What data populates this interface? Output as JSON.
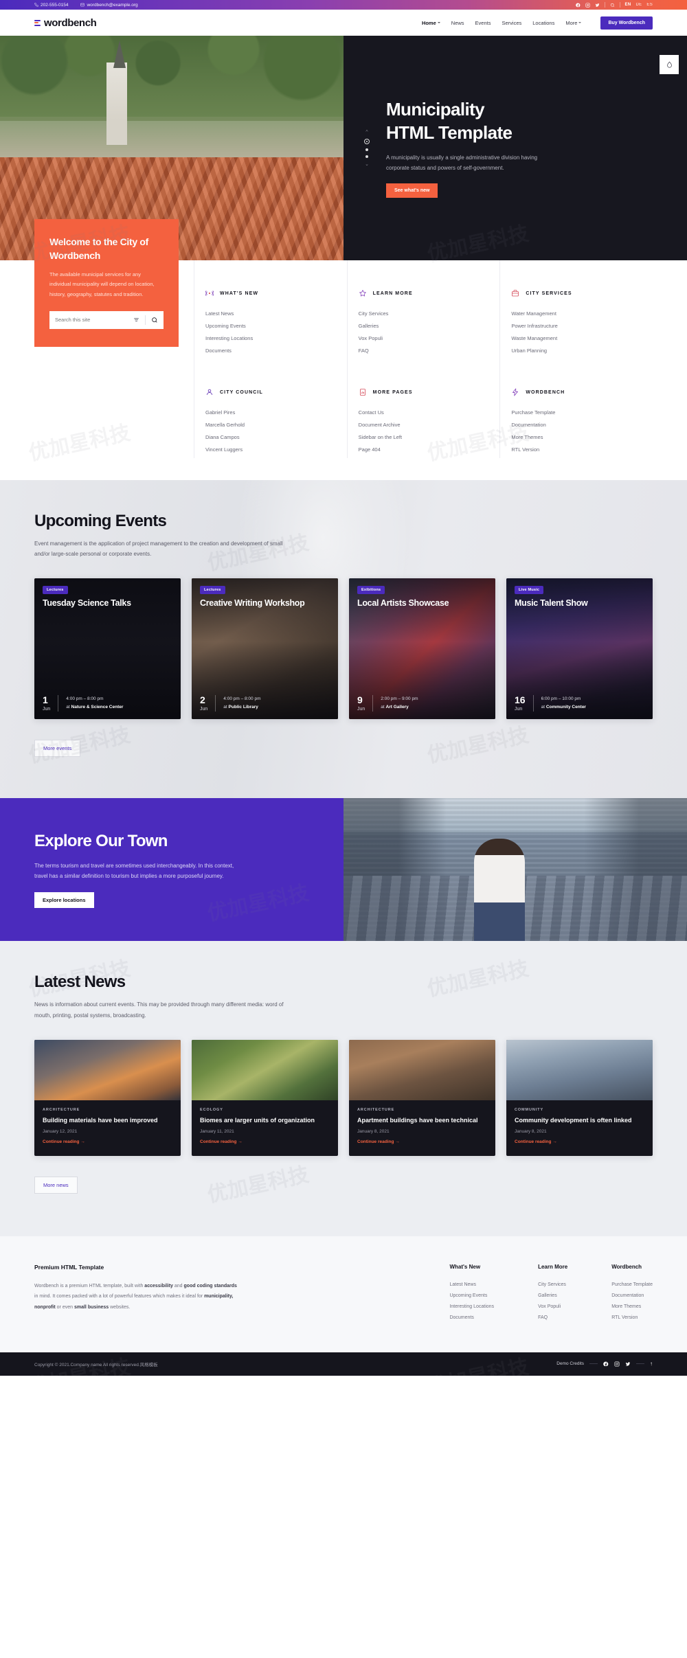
{
  "topbar": {
    "phone": "202-555-0154",
    "email": "wordbench@example.org",
    "socials": [
      "facebook-icon",
      "instagram-icon",
      "twitter-icon"
    ],
    "search_icon": "search-icon",
    "languages": [
      {
        "code": "EN",
        "active": true
      },
      {
        "code": "DE",
        "active": false
      },
      {
        "code": "ES",
        "active": false
      }
    ],
    "gradient_from": "#4b2bbd",
    "gradient_to": "#f4613f"
  },
  "header": {
    "logo": "wordbench",
    "nav": [
      {
        "label": "Home",
        "has_caret": true,
        "active": true
      },
      {
        "label": "News",
        "has_caret": false,
        "active": false
      },
      {
        "label": "Events",
        "has_caret": false,
        "active": false
      },
      {
        "label": "Services",
        "has_caret": false,
        "active": false
      },
      {
        "label": "Locations",
        "has_caret": false,
        "active": false
      },
      {
        "label": "More",
        "has_caret": true,
        "active": false
      }
    ],
    "cta": "Buy Wordbench",
    "cta_color": "#4b2bbd"
  },
  "hero": {
    "title_line1": "Municipality",
    "title_line2": "HTML Template",
    "paragraph": "A municipality is usually a single administrative division having corporate status and powers of self-government.",
    "button": "See what's new",
    "button_color": "#f4613f",
    "slides_total": 3,
    "slide_current": 1,
    "badge_icon": "droplet-icon"
  },
  "welcome": {
    "title": "Welcome to the City of Wordbench",
    "paragraph": "The available municipal services for any individual municipality will depend on location, history, geography, statutes and tradition.",
    "search_placeholder": "Search this site",
    "search_value": "",
    "filter_icon": "filter-icon",
    "search_icon": "search-icon",
    "bg_color": "#f4613f"
  },
  "quicklinks": [
    {
      "icon": "broadcast-icon",
      "title": "WHAT'S NEW",
      "items": [
        "Latest News",
        "Upcoming Events",
        "Interesting Locations",
        "Documents"
      ]
    },
    {
      "icon": "star-icon",
      "title": "LEARN MORE",
      "items": [
        "City Services",
        "Galleries",
        "Vox Populi",
        "FAQ"
      ]
    },
    {
      "icon": "briefcase-icon",
      "title": "CITY SERVICES",
      "items": [
        "Water Management",
        "Power Infrastructure",
        "Waste Management",
        "Urban Planning"
      ]
    },
    {
      "icon": "user-icon",
      "title": "CITY COUNCIL",
      "items": [
        "Gabriel Pires",
        "Marcella Gerhold",
        "Diana Campos",
        "Vincent Luggers"
      ]
    },
    {
      "icon": "chart-clipboard-icon",
      "title": "MORE PAGES",
      "items": [
        "Contact Us",
        "Document Archive",
        "Sidebar on the Left",
        "Page 404"
      ]
    },
    {
      "icon": "bolt-icon",
      "title": "WORDBENCH",
      "items": [
        "Purchase Template",
        "Documentation",
        "More Themes",
        "RTL Version"
      ]
    }
  ],
  "events": {
    "heading": "Upcoming Events",
    "paragraph": "Event management is the application of project management to the creation and development of small and/or large-scale personal or corporate events.",
    "more_button": "More events",
    "cards": [
      {
        "tag": "Lectures",
        "title": "Tuesday Science Talks",
        "day": "1",
        "month": "Jun",
        "time": "4:00 pm – 8:00 pm",
        "place_prefix": "at ",
        "place": "Nature & Science Center"
      },
      {
        "tag": "Lectures",
        "title": "Creative Writing Workshop",
        "day": "2",
        "month": "Jun",
        "time": "4:00 pm – 8:00 pm",
        "place_prefix": "at ",
        "place": "Public Library"
      },
      {
        "tag": "Exibitions",
        "title": "Local Artists Showcase",
        "day": "9",
        "month": "Jun",
        "time": "2:00 pm – 9:00 pm",
        "place_prefix": "at ",
        "place": "Art Gallery"
      },
      {
        "tag": "Live Music",
        "title": "Music Talent Show",
        "day": "16",
        "month": "Jun",
        "time": "6:00 pm – 10:00 pm",
        "place_prefix": "at ",
        "place": "Community Center"
      }
    ]
  },
  "explore": {
    "heading": "Explore Our Town",
    "paragraph": "The terms tourism and travel are sometimes used interchangeably. In this context, travel has a similar definition to tourism but implies a more purposeful journey.",
    "button": "Explore locations",
    "bg_color": "#4b2bbd"
  },
  "news": {
    "heading": "Latest News",
    "paragraph": "News is information about current events. This may be provided through many different media: word of mouth, printing, postal systems, broadcasting.",
    "more_button": "More news",
    "read_more": "Continue reading",
    "cards": [
      {
        "category": "ARCHITECTURE",
        "title": "Building materials have been improved",
        "date": "January 12, 2021"
      },
      {
        "category": "ECOLOGY",
        "title": "Biomes are larger units of organization",
        "date": "January 11, 2021"
      },
      {
        "category": "ARCHITECTURE",
        "title": "Apartment buildings have been technical",
        "date": "January 8, 2021"
      },
      {
        "category": "COMMUNITY",
        "title": "Community development is often linked",
        "date": "January 8, 2021"
      }
    ]
  },
  "footer": {
    "about_title": "Premium HTML Template",
    "about_p1": "Wordbench is a premium HTML template, built with ",
    "about_b1": "accessibility",
    "about_p2": " and ",
    "about_b2": "good coding standards",
    "about_p3": " in mind. It comes packed with a lot of powerful features which makes it ideal for ",
    "about_b3": "municipality, nonprofit",
    "about_p4": " or even ",
    "about_b4": "small business",
    "about_p5": " websites.",
    "columns": [
      {
        "title": "What's New",
        "items": [
          "Latest News",
          "Upcoming Events",
          "Interesting Locations",
          "Documents"
        ]
      },
      {
        "title": "Learn More",
        "items": [
          "City Services",
          "Galleries",
          "Vox Populi",
          "FAQ"
        ]
      },
      {
        "title": "Wordbench",
        "items": [
          "Purchase Template",
          "Documentation",
          "More Themes",
          "RTL Version"
        ]
      }
    ],
    "copyright": "Copyright © 2021.Company name All rights reserved.风格模板",
    "credits": "Demo Credits",
    "socials": [
      "facebook-icon",
      "instagram-icon",
      "twitter-icon"
    ],
    "to_top_icon": "arrow-up-icon"
  },
  "watermark": "优加星科技"
}
